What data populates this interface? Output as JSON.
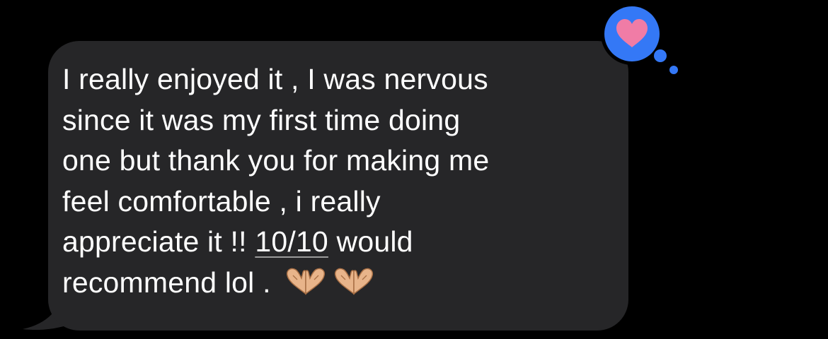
{
  "message": {
    "line1": "I really enjoyed it , I was nervous",
    "line2": "since it was my first time doing",
    "line3": "one but thank you for making me",
    "line4": "feel comfortable , i really",
    "line5_before": "appreciate it !! ",
    "line5_link": "10/10",
    "line5_after": " would",
    "line6": "recommend lol . ",
    "emoji": "heart-hands-emoji"
  },
  "tapback": {
    "icon": "heart-icon",
    "reaction": "heart"
  },
  "colors": {
    "background": "#000000",
    "bubble": "#262628",
    "text": "#ffffff",
    "tapback_bubble": "#3478f6",
    "heart": "#f07ca6"
  }
}
